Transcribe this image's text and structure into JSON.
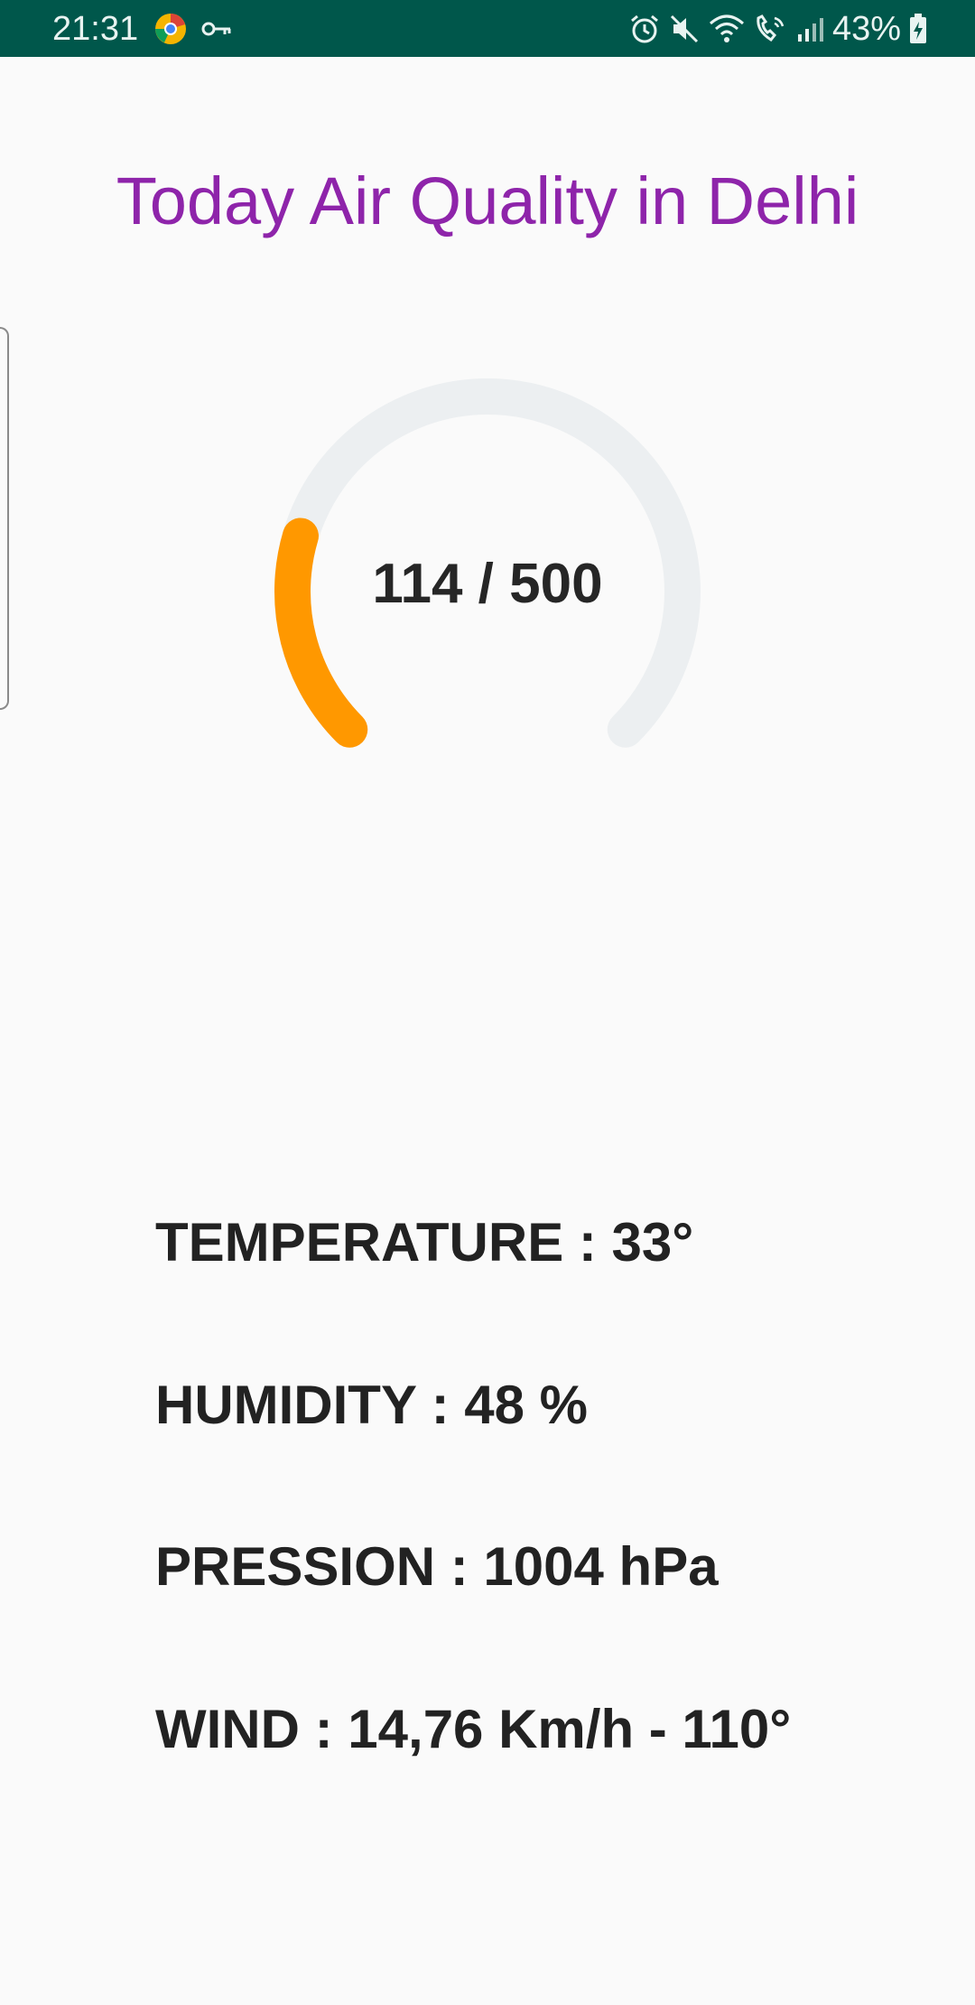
{
  "status_bar": {
    "time": "21:31",
    "battery_text": "43%",
    "left_icons": [
      "chrome-style-app-icon",
      "vpn-key-icon"
    ],
    "right_icons": [
      "alarm-icon",
      "mute-icon",
      "wifi-icon",
      "wifi-calling-icon",
      "signal-icon",
      "battery-charging-icon"
    ],
    "background_color": "#00574b"
  },
  "title": "Today Air Quality in Delhi",
  "gauge": {
    "value_text": "114 / 500",
    "value": 114,
    "max": 500,
    "progress_color": "#ff9800",
    "track_color": "#eceff1"
  },
  "metrics": [
    {
      "label": "TEMPERATURE : 33°"
    },
    {
      "label": "HUMIDITY : 48 %"
    },
    {
      "label": "PRESSION : 1004 hPa"
    },
    {
      "label": "WIND : 14,76 Km/h - 110°"
    }
  ],
  "colors": {
    "title": "#8e24aa",
    "text": "#222222",
    "background": "#fafafa"
  }
}
